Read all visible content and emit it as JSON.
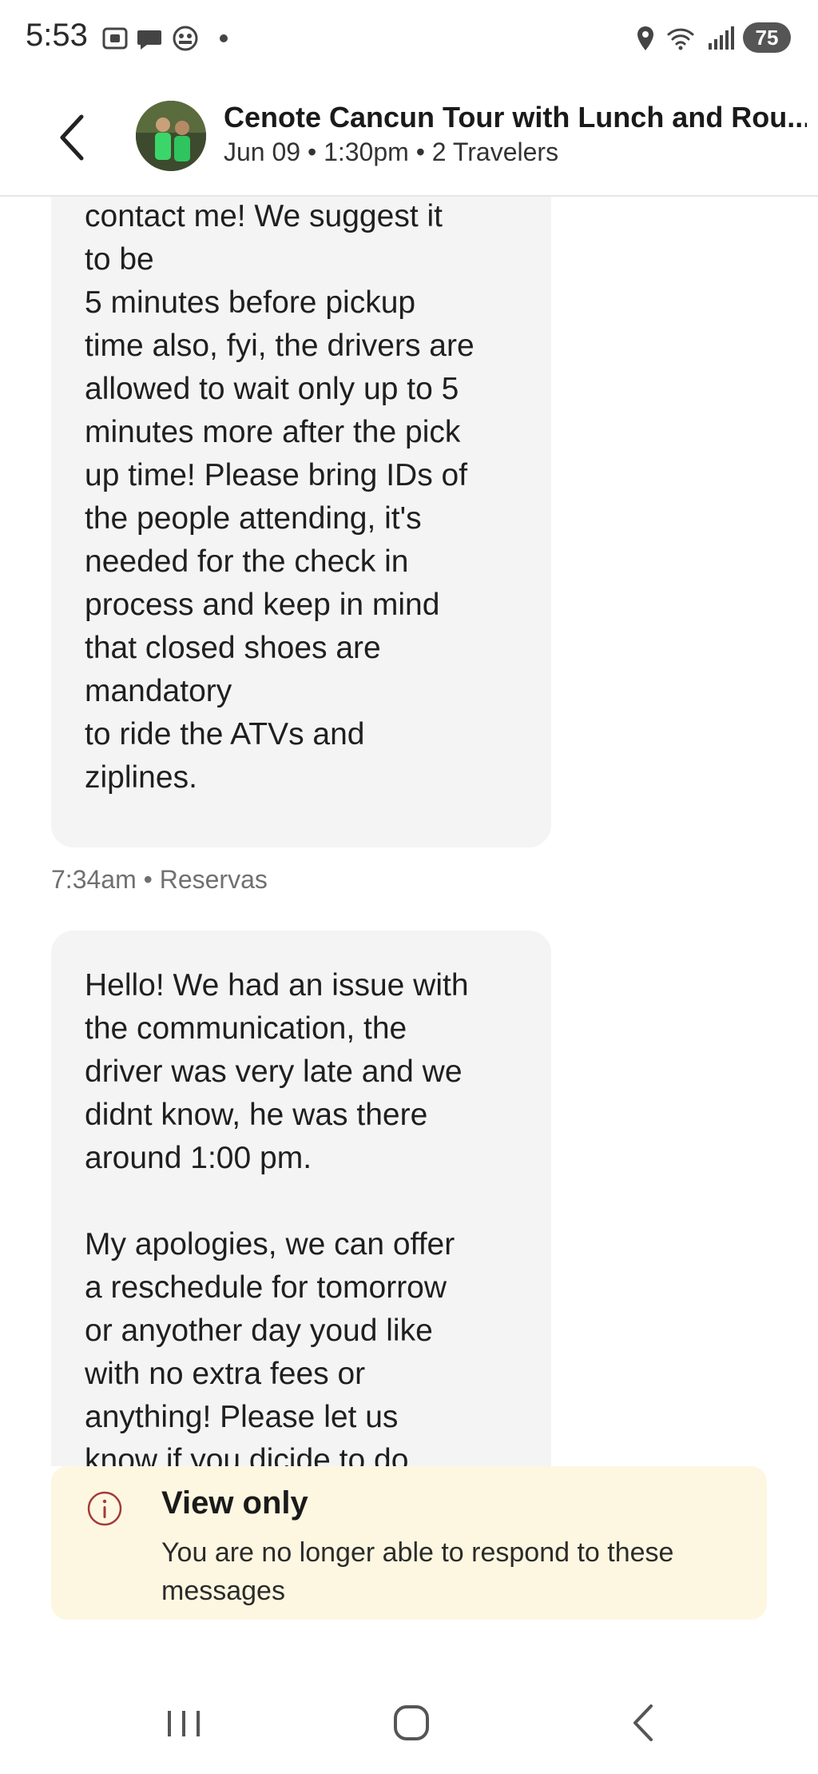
{
  "status_bar": {
    "time": "5:53",
    "battery": "75",
    "icons": [
      "screenshot-icon",
      "chat-icon",
      "game-icon",
      "dot-icon",
      "location-icon",
      "wifi-icon",
      "signal-icon",
      "battery-icon"
    ]
  },
  "header": {
    "title": "Cenote Cancun Tour with Lunch and Rou...",
    "subtitle": "Jun 09 • 1:30pm • 2 Travelers"
  },
  "messages": [
    {
      "text": "other questions feel free to\ncontact me! We suggest it\nto be\n5 minutes before pickup\ntime also, fyi, the drivers are\nallowed to wait only up to 5\nminutes more after the pick\nup time! Please bring IDs of\nthe people attending, it's\nneeded for the check in\nprocess and keep in mind\nthat closed shoes are\nmandatory\nto ride the ATVs and\nziplines.",
      "meta": "7:34am • Reservas"
    },
    {
      "text": "Hello! We had an issue with\nthe communication, the\ndriver was very late and we\ndidnt know, he was there\naround 1:00 pm.\n\nMy apologies, we can offer\na reschedule for tomorrow\nor anyother day youd like\nwith no extra fees or\nanything! Please let us\nknow if you dicide to do"
    }
  ],
  "banner": {
    "title": "View only",
    "text": "You are no longer able to respond to these messages",
    "accent": "#a33a3a",
    "background": "#fdf7e1"
  },
  "colors": {
    "bubble": "#f4f4f4",
    "meta_text": "#707070"
  }
}
